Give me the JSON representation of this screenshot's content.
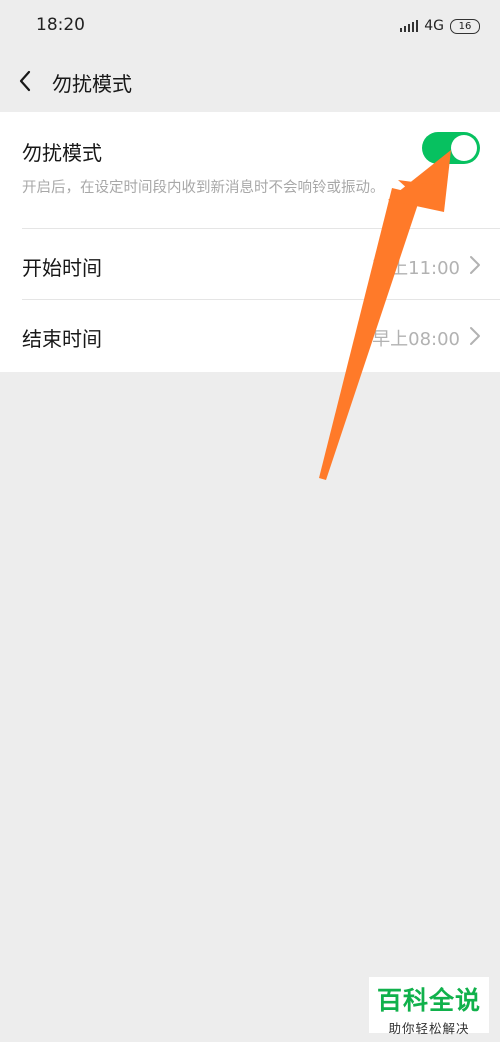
{
  "status_bar": {
    "time": "18:20",
    "network": "4G",
    "network_sub": "..ll",
    "battery": "16"
  },
  "header": {
    "back_icon": "chevron-left-icon",
    "title": "勿扰模式"
  },
  "settings": {
    "dnd": {
      "title": "勿扰模式",
      "description": "开启后，在设定时间段内收到新消息时不会响铃或振动。",
      "enabled": true,
      "toggle_color": "#07c160"
    },
    "start_time": {
      "label": "开始时间",
      "value": "晚上11:00"
    },
    "end_time": {
      "label": "结束时间",
      "value": "早上08:00"
    }
  },
  "watermark": {
    "title": "百科全说",
    "subtitle": "助你轻松解决"
  },
  "colors": {
    "accent": "#07c160",
    "annotation_arrow": "#ff7a29",
    "watermark_green": "#10b14b"
  }
}
